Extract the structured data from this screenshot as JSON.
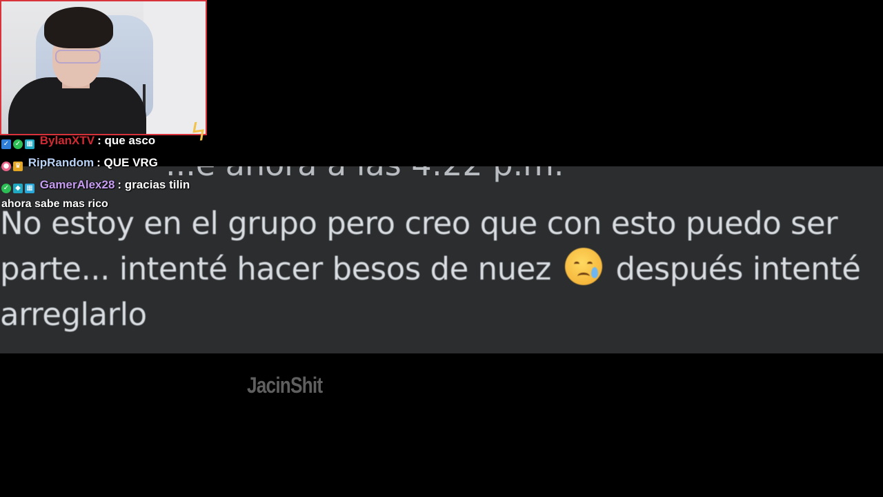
{
  "post": {
    "cut_text": "...e ahora a las 4:22 p.m.",
    "line1": "No estoy en el grupo pero creo que con esto puedo ser",
    "line2_a": "parte... intenté hacer besos de nuez",
    "line2_b": "después intenté",
    "line3": "arreglarlo"
  },
  "chat": {
    "messages": [
      {
        "user": "BylanXTV",
        "user_color": "#d12a32",
        "text": ": que asco",
        "badges": [
          "blue",
          "green",
          "cyan"
        ]
      },
      {
        "user": "RipRandom",
        "user_color": "#b8d3f5",
        "text": ": QUE VRG",
        "badges": [
          "pink",
          "gold"
        ]
      },
      {
        "user": "GamerAlex28",
        "user_color": "#c79df2",
        "text": ": gracias tilin",
        "badges": [
          "green",
          "cyan",
          "tealbox"
        ]
      },
      {
        "user": "",
        "user_color": "#ffffff",
        "text": "ahora sabe mas rico",
        "badges": []
      }
    ]
  },
  "watermark": "JacinShit",
  "colors": {
    "webcam_border": "#d8323a",
    "panel_bg": "#2b2d2f"
  }
}
